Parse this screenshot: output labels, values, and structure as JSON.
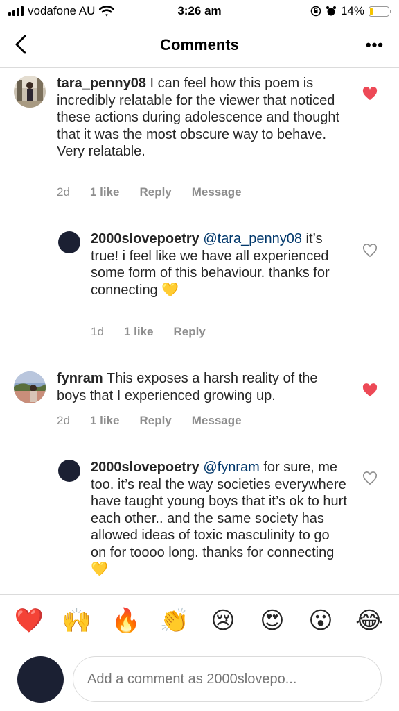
{
  "status_bar": {
    "carrier": "vodafone AU",
    "time": "3:26 am",
    "battery": "14%",
    "battery_level": 0.14
  },
  "header": {
    "title": "Comments"
  },
  "comments": [
    {
      "username": "tara_penny08",
      "text": " I can feel how this poem is incredibly relatable for the viewer that noticed these actions during adolescence and thought that it was the most obscure way to behave. Very relatable.",
      "time": "2d",
      "likes": "1 like",
      "reply_label": "Reply",
      "message_label": "Message",
      "liked": true
    },
    {
      "username": "2000slovepoetry",
      "mention": "@tara_penny08",
      "text": " it’s true! i feel like we have all experienced some form of this behaviour. thanks for connecting ",
      "emoji": "💛",
      "time": "1d",
      "likes": "1 like",
      "reply_label": "Reply",
      "liked": false
    },
    {
      "username": "fynram",
      "text": " This exposes a harsh reality of the boys that I experienced growing up.",
      "time": "2d",
      "likes": "1 like",
      "reply_label": "Reply",
      "message_label": "Message",
      "liked": true
    },
    {
      "username": "2000slovepoetry",
      "mention": "@fynram",
      "text": " for sure, me too. it’s real the way societies everywhere have taught young boys that it’s ok to hurt each other.. and the same society has allowed ideas of toxic masculinity to go on for toooo long. thanks for connecting ",
      "emoji": "💛",
      "liked": false
    }
  ],
  "emoji_bar": [
    "❤️",
    "🙌",
    "🔥",
    "👏",
    "😢",
    "😍",
    "😮",
    "😂"
  ],
  "composer": {
    "placeholder": "Add a comment as 2000slovepo..."
  },
  "colors": {
    "heart_liked": "#ed4956",
    "mention": "#00376b",
    "muted": "#8e8e8e"
  }
}
